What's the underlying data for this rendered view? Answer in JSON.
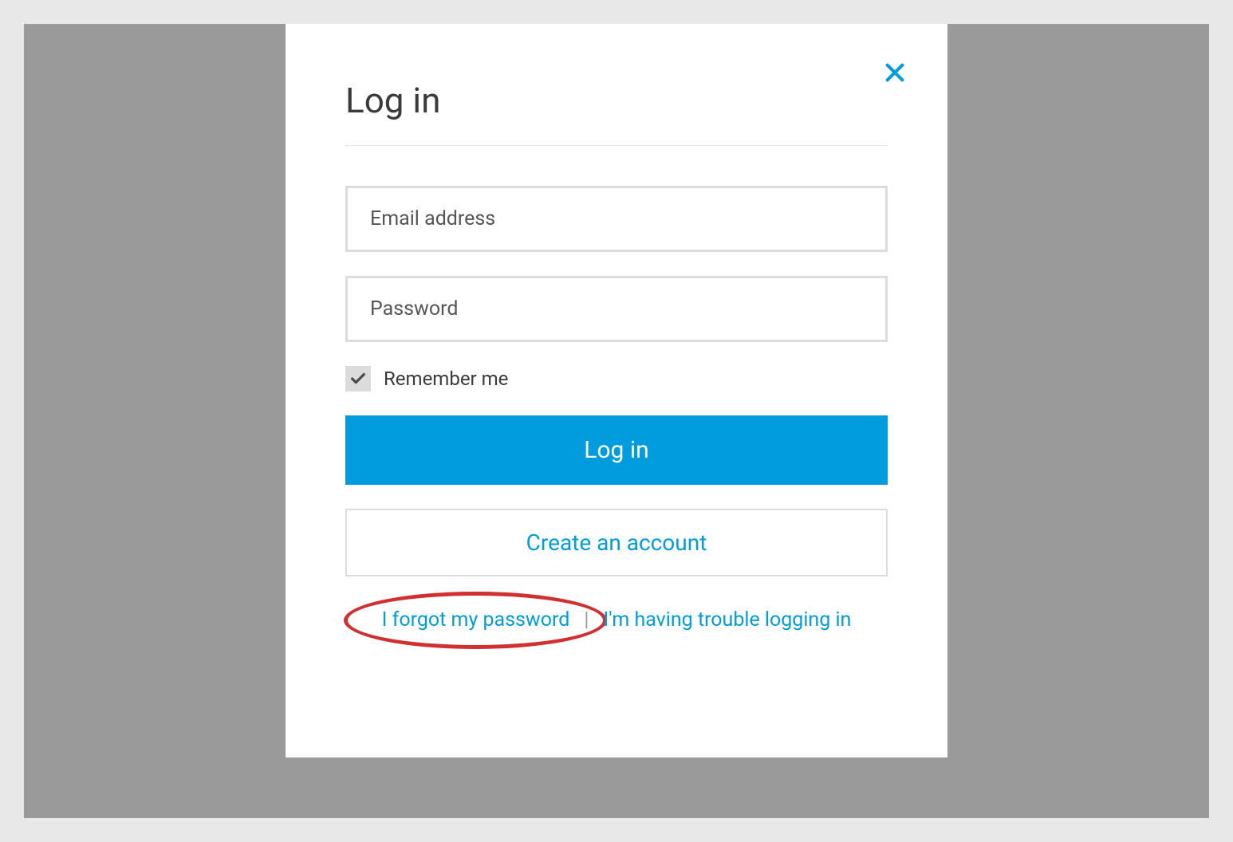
{
  "modal": {
    "title": "Log in",
    "email_placeholder": "Email address",
    "password_placeholder": "Password",
    "remember_label": "Remember me",
    "login_button": "Log in",
    "create_account_button": "Create an account",
    "forgot_password_link": "I forgot my password",
    "trouble_link": "I'm having trouble logging in"
  },
  "colors": {
    "accent": "#009cde",
    "highlight": "#d03030"
  }
}
